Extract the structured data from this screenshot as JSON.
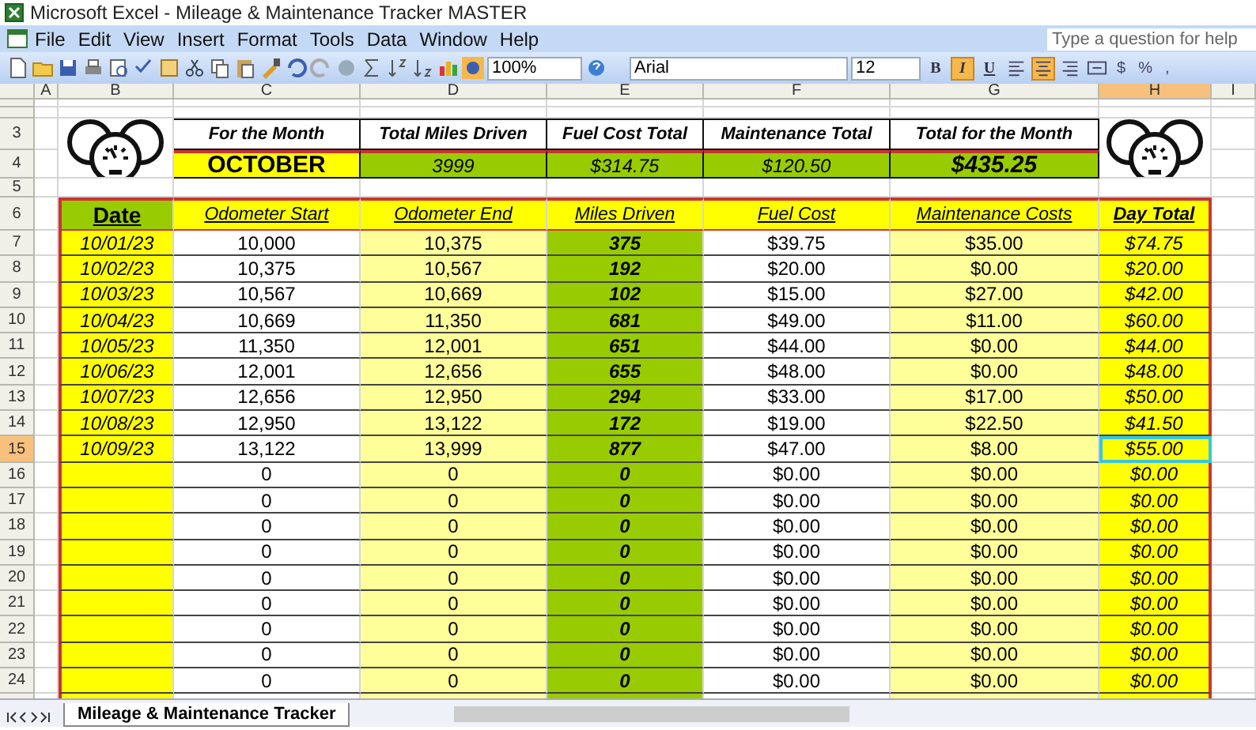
{
  "window": {
    "title": "Microsoft Excel - Mileage & Maintenance Tracker MASTER"
  },
  "menu": [
    "File",
    "Edit",
    "View",
    "Insert",
    "Format",
    "Tools",
    "Data",
    "Window",
    "Help"
  ],
  "help": {
    "placeholder": "Type a question for help"
  },
  "toolbar": {
    "zoom": "100%",
    "font": "Arial",
    "size": "12",
    "format_buttons": [
      {
        "kind": "bold",
        "label": "B",
        "on": false
      },
      {
        "kind": "italic",
        "label": "I",
        "on": true
      },
      {
        "kind": "underline",
        "label": "U",
        "on": false
      },
      {
        "kind": "align-left",
        "on": false
      },
      {
        "kind": "align-center",
        "on": true
      },
      {
        "kind": "align-right",
        "on": false
      },
      {
        "kind": "merge",
        "on": false
      }
    ],
    "number_buttons": [
      "$",
      "%",
      ","
    ]
  },
  "columns": [
    {
      "label": "A",
      "selected": false
    },
    {
      "label": "B",
      "selected": false
    },
    {
      "label": "C",
      "selected": false
    },
    {
      "label": "D",
      "selected": false
    },
    {
      "label": "E",
      "selected": false
    },
    {
      "label": "F",
      "selected": false
    },
    {
      "label": "G",
      "selected": false
    },
    {
      "label": "H",
      "selected": true
    },
    {
      "label": "I",
      "selected": false
    }
  ],
  "top_rows": [
    "3",
    "4",
    "5",
    "6"
  ],
  "summary": {
    "headers": [
      "For the Month",
      "Total Miles Driven",
      "Fuel Cost Total",
      "Maintenance Total",
      "Total for the Month"
    ],
    "values": [
      {
        "kind": "month",
        "text": "OCTOBER"
      },
      {
        "kind": "figure",
        "text": "3999"
      },
      {
        "kind": "figure",
        "text": "$314.75"
      },
      {
        "kind": "figure",
        "text": "$120.50"
      },
      {
        "kind": "total",
        "text": "$435.25"
      }
    ]
  },
  "table": {
    "columns": [
      "Date",
      "Odometer Start",
      "Odometer End",
      "Miles Driven",
      "Fuel Cost",
      "Maintenance Costs",
      "Day Total"
    ],
    "rows": [
      {
        "number": "7",
        "selected": false,
        "cells": [
          "10/01/23",
          "10,000",
          "10,375",
          "375",
          "$39.75",
          "$35.00",
          "$74.75"
        ]
      },
      {
        "number": "8",
        "selected": false,
        "cells": [
          "10/02/23",
          "10,375",
          "10,567",
          "192",
          "$20.00",
          "$0.00",
          "$20.00"
        ]
      },
      {
        "number": "9",
        "selected": false,
        "cells": [
          "10/03/23",
          "10,567",
          "10,669",
          "102",
          "$15.00",
          "$27.00",
          "$42.00"
        ]
      },
      {
        "number": "10",
        "selected": false,
        "cells": [
          "10/04/23",
          "10,669",
          "11,350",
          "681",
          "$49.00",
          "$11.00",
          "$60.00"
        ]
      },
      {
        "number": "11",
        "selected": false,
        "cells": [
          "10/05/23",
          "11,350",
          "12,001",
          "651",
          "$44.00",
          "$0.00",
          "$44.00"
        ]
      },
      {
        "number": "12",
        "selected": false,
        "cells": [
          "10/06/23",
          "12,001",
          "12,656",
          "655",
          "$48.00",
          "$0.00",
          "$48.00"
        ]
      },
      {
        "number": "13",
        "selected": false,
        "cells": [
          "10/07/23",
          "12,656",
          "12,950",
          "294",
          "$33.00",
          "$17.00",
          "$50.00"
        ]
      },
      {
        "number": "14",
        "selected": false,
        "cells": [
          "10/08/23",
          "12,950",
          "13,122",
          "172",
          "$19.00",
          "$22.50",
          "$41.50"
        ]
      },
      {
        "number": "15",
        "selected": true,
        "cells": [
          "10/09/23",
          "13,122",
          "13,999",
          "877",
          "$47.00",
          "$8.00",
          "$55.00"
        ]
      },
      {
        "number": "16",
        "selected": false,
        "cells": [
          "",
          "0",
          "0",
          "0",
          "$0.00",
          "$0.00",
          "$0.00"
        ]
      },
      {
        "number": "17",
        "selected": false,
        "cells": [
          "",
          "0",
          "0",
          "0",
          "$0.00",
          "$0.00",
          "$0.00"
        ]
      },
      {
        "number": "18",
        "selected": false,
        "cells": [
          "",
          "0",
          "0",
          "0",
          "$0.00",
          "$0.00",
          "$0.00"
        ]
      },
      {
        "number": "19",
        "selected": false,
        "cells": [
          "",
          "0",
          "0",
          "0",
          "$0.00",
          "$0.00",
          "$0.00"
        ]
      },
      {
        "number": "20",
        "selected": false,
        "cells": [
          "",
          "0",
          "0",
          "0",
          "$0.00",
          "$0.00",
          "$0.00"
        ]
      },
      {
        "number": "21",
        "selected": false,
        "cells": [
          "",
          "0",
          "0",
          "0",
          "$0.00",
          "$0.00",
          "$0.00"
        ]
      },
      {
        "number": "22",
        "selected": false,
        "cells": [
          "",
          "0",
          "0",
          "0",
          "$0.00",
          "$0.00",
          "$0.00"
        ]
      },
      {
        "number": "23",
        "selected": false,
        "cells": [
          "",
          "0",
          "0",
          "0",
          "$0.00",
          "$0.00",
          "$0.00"
        ]
      },
      {
        "number": "24",
        "selected": false,
        "cells": [
          "",
          "0",
          "0",
          "0",
          "$0.00",
          "$0.00",
          "$0.00"
        ]
      }
    ]
  },
  "sheet_tabs": [
    {
      "label": "Mileage & Maintenance Tracker",
      "selected": true
    }
  ]
}
